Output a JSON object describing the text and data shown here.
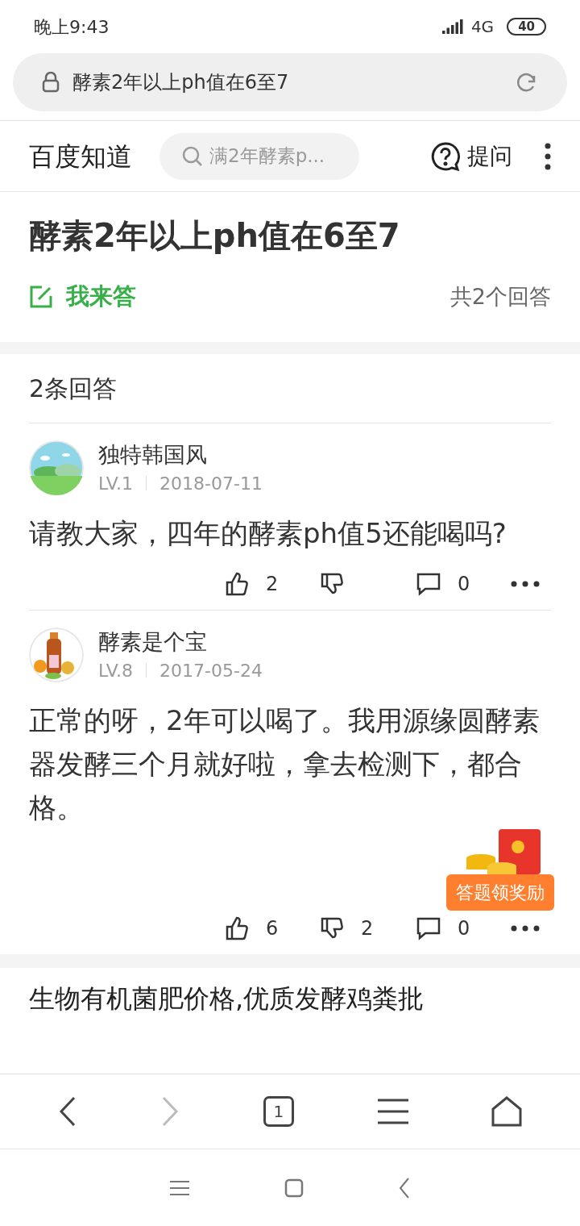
{
  "status_bar": {
    "time": "晚上9:43",
    "network": "4G",
    "battery": "40"
  },
  "address_bar": {
    "url": "酵素2年以上ph值在6至7"
  },
  "header": {
    "logo": "百度知道",
    "search_placeholder": "满2年酵素p...",
    "ask": "提问"
  },
  "question": {
    "title": "酵素2年以上ph值在6至7",
    "answer_link": "我来答",
    "answer_total": "共2个回答"
  },
  "answers_heading": "2条回答",
  "answers": [
    {
      "user": "独特韩国风",
      "level": "LV.1",
      "date": "2018-07-11",
      "text": "请教大家，四年的酵素ph值5还能喝吗?",
      "likes": "2",
      "comments": "0"
    },
    {
      "user": "酵素是个宝",
      "level": "LV.8",
      "date": "2017-05-24",
      "text": "正常的呀，2年可以喝了。我用源缘圆酵素器发酵三个月就好啦，拿去检测下，都合格。",
      "likes": "6",
      "dislikes": "2",
      "comments": "0"
    }
  ],
  "reward_badge": "答题领奖励",
  "next_item": "生物有机菌肥价格,优质发酵鸡粪批",
  "browser_toolbar": {
    "back_disabled": false,
    "forward_disabled": true,
    "tabs_count": "1"
  }
}
